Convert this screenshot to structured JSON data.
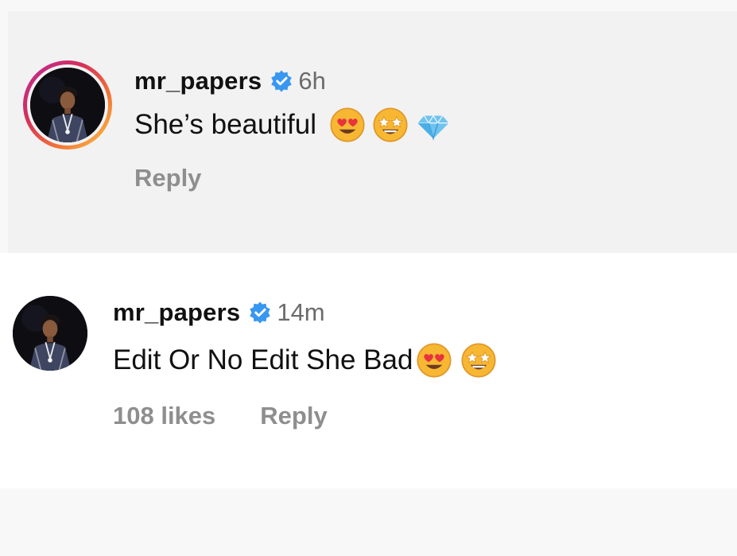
{
  "comments": [
    {
      "username": "mr_papers",
      "verified": true,
      "timestamp": "6h",
      "text": "She’s beautiful",
      "emojis": [
        "heart-eyes-emoji",
        "star-struck-emoji",
        "gem-stone-emoji"
      ],
      "reply_label": "Reply",
      "has_story_ring": true,
      "highlighted": true
    },
    {
      "username": "mr_papers",
      "verified": true,
      "timestamp": "14m",
      "text": "Edit Or No Edit She Bad",
      "emojis": [
        "heart-eyes-emoji",
        "star-struck-emoji"
      ],
      "likes": "108 likes",
      "reply_label": "Reply",
      "has_story_ring": false,
      "highlighted": false
    }
  ],
  "colors": {
    "verified_badge": "#3897f0",
    "meta_text": "#8e8e8e",
    "highlight_bg": "#f2f2f2"
  }
}
